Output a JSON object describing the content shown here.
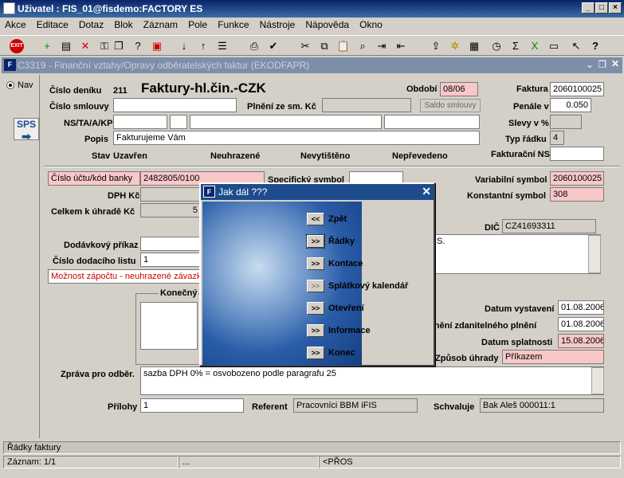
{
  "window": {
    "title": "Uživatel : FIS_01@fisdemo:FACTORY ES"
  },
  "menu": [
    "Akce",
    "Editace",
    "Dotaz",
    "Blok",
    "Záznam",
    "Pole",
    "Funkce",
    "Nástroje",
    "Nápověda",
    "Okno"
  ],
  "form_title": "C3319 - Finanční vztahy/Opravy odběratelských faktur (EKODFAPR)",
  "left": {
    "nav_label": "Nav",
    "sps_label": "SPS"
  },
  "header": {
    "cislo_deniku_label": "Číslo deníku",
    "cislo_deniku": "211",
    "doc_title": "Faktury-hl.čin.-CZK",
    "obdobi_label": "Období",
    "obdobi": "08/06",
    "faktura_label": "Faktura",
    "faktura": "2060100025",
    "cislo_smlouvy_label": "Číslo smlouvy",
    "plneni_label": "Plnění ze sm. Kč",
    "saldo_button": "Saldo smlouvy",
    "penale_label": "Penále v %",
    "penale": "0.050",
    "ns_label": "NS/TA/A/KP",
    "slevy_label": "Slevy v %",
    "popis_label": "Popis",
    "popis": "Fakturujeme Vám",
    "typ_radku_label": "Typ řádku",
    "typ_radku": "4",
    "stav_label": "Stav",
    "stav_values": [
      "Uzavřen",
      "Neuhrazené",
      "Nevytištěno",
      "Nepřevedeno"
    ],
    "fakturacni_ns_label": "Fakturační NS"
  },
  "body": {
    "ucet_label": "Číslo účtu/kód banky",
    "ucet": "2482805/0100",
    "specificky_label": "Specifický symbol",
    "variabilni_label": "Variabilní symbol",
    "variabilni": "2060100025",
    "dph_label": "DPH Kč",
    "konstantni_label": "Konstantní symbol",
    "konstantni": "308",
    "celkem_label": "Celkem k úhradě Kč",
    "celkem": "5",
    "dic_label": "DIČ",
    "dic": "CZ41693311",
    "address_tail": "S.",
    "dodavkovy_label": "Dodávkový příkaz",
    "dodaci_label": "Číslo dodacího listu",
    "dodaci": "1",
    "zapocet": "Možnost zápočtu - neuhrazené závazky",
    "konecny_label": "Konečný",
    "datum_vystaveni_label": "Datum vystavení",
    "datum_vystaveni": "01.08.2006",
    "datum_zdanitelneho_label": "Uskutečnění zdanitelného plnění",
    "datum_zdanitelneho": "01.08.2006",
    "datum_splatnosti_label": "Datum splatnosti",
    "datum_splatnosti": "15.08.2006",
    "zpusob_label": "Způsob úhrady",
    "zpusob": "Příkazem",
    "zprava_label": "Zpráva pro odběr.",
    "zprava": "sazba DPH 0% = osvobozeno podle paragrafu 25",
    "prilohy_label": "Přílohy",
    "prilohy": "1",
    "referent_label": "Referent",
    "referent": "Pracovníci BBM iFIS",
    "schvaluje_label": "Schvaluje",
    "schvaluje": "Bak Aleš 000011:1"
  },
  "dialog": {
    "title": "Jak dál ???",
    "items": [
      {
        "btn": "<<",
        "label": "Zpět"
      },
      {
        "btn": ">>",
        "label": "Řádky"
      },
      {
        "btn": ">>",
        "label": "Kontace"
      },
      {
        "btn": ">>",
        "label": "Splátkový kalendář"
      },
      {
        "btn": ">>",
        "label": "Otevření"
      },
      {
        "btn": ">>",
        "label": "Informace"
      },
      {
        "btn": ">>",
        "label": "Konec"
      }
    ]
  },
  "status": {
    "hint": "Řádky faktury",
    "record": "Záznam: 1/1",
    "dots": "...",
    "mode": "<PŘOS"
  },
  "icons": [
    "exit-icon",
    "insert-record-icon",
    "delete-record-icon",
    "lock-icon",
    "print-icon",
    "cut-icon",
    "copy-icon",
    "paste-icon",
    "search-icon",
    "sum-icon",
    "excel-icon",
    "help-icon"
  ],
  "colors": {
    "pink_field": "#f8c8c8",
    "title_blue": "#0a246a"
  }
}
